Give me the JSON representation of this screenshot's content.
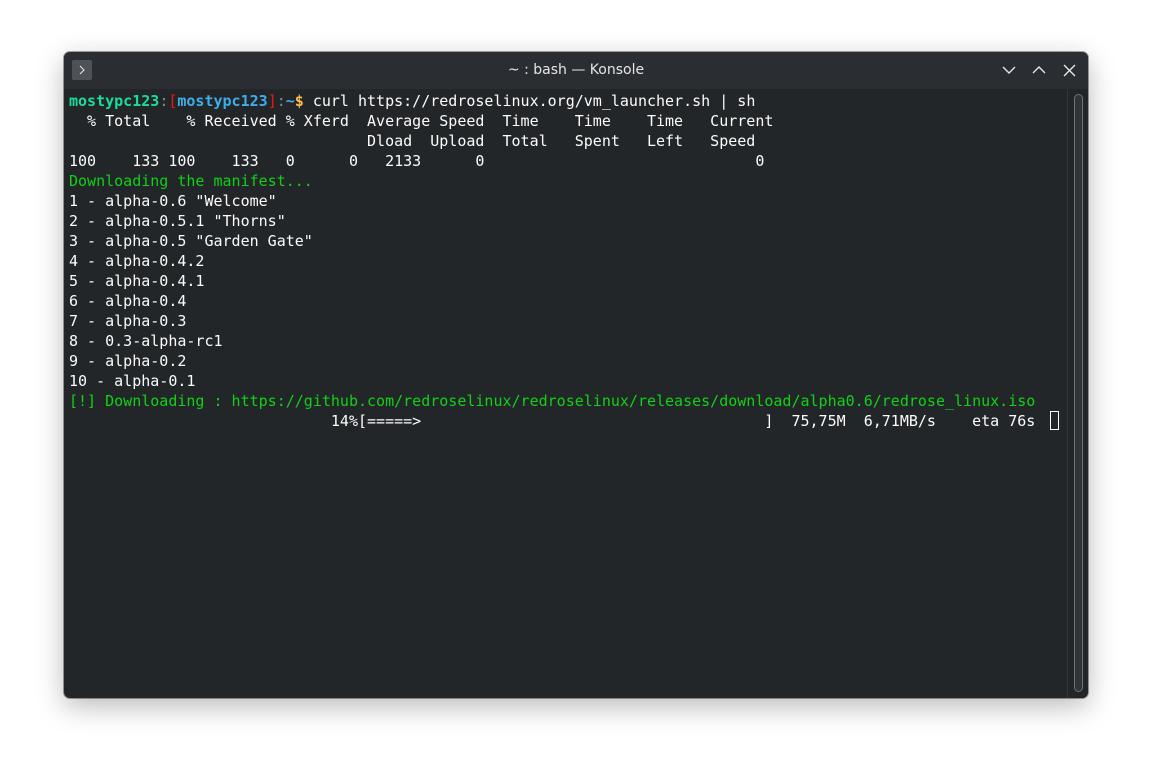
{
  "window": {
    "title": "~ : bash — Konsole"
  },
  "prompt": {
    "user": "mostypc123",
    "colon1": ":",
    "bracket_open": "[",
    "host": "mostypc123",
    "bracket_close": "]",
    "colon2": ":",
    "path": "~",
    "symbol": "$",
    "command": " curl https://redroselinux.org/vm_launcher.sh | sh"
  },
  "curl_table": {
    "header1": "  % Total    % Received % Xferd  Average Speed  Time    Time    Time   Current",
    "header2": "                                 Dload  Upload  Total   Spent   Left   Speed",
    "row": "100    133 100    133   0      0   2133      0                              0"
  },
  "status_line": "Downloading the manifest...",
  "releases": [
    "1 - alpha-0.6 \"Welcome\"",
    "2 - alpha-0.5.1 \"Thorns\"",
    "3 - alpha-0.5 \"Garden Gate\"",
    "4 - alpha-0.4.2",
    "5 - alpha-0.4.1",
    "6 - alpha-0.4",
    "7 - alpha-0.3",
    "8 - 0.3-alpha-rc1",
    "9 - alpha-0.2",
    "10 - alpha-0.1"
  ],
  "download_line": "[!] Downloading : https://github.com/redroselinux/redroselinux/releases/download/alpha0.6/redrose_linux.iso",
  "progress_line": "                             14%[=====>                                      ]  75,75M  6,71MB/s    eta 76s",
  "progress_percent": 14,
  "colors": {
    "background": "#232629",
    "titlebar": "#2a2e32",
    "user_green": "#1cdc9a",
    "host_blue": "#3daee9",
    "bracket_red": "#ed1515",
    "download_green": "#11d116"
  }
}
